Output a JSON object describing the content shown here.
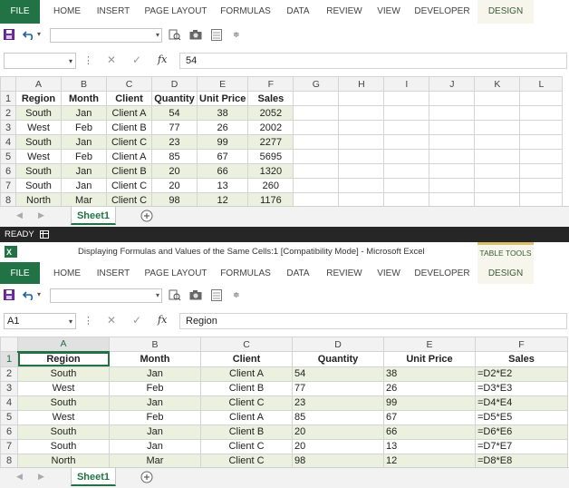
{
  "top": {
    "ribbon_tabs": [
      "FILE",
      "HOME",
      "INSERT",
      "PAGE LAYOUT",
      "FORMULAS",
      "DATA",
      "REVIEW",
      "VIEW",
      "DEVELOPER",
      "DESIGN"
    ],
    "name_box": "",
    "formula": "54",
    "columns": [
      "A",
      "B",
      "C",
      "D",
      "E",
      "F",
      "G",
      "H",
      "I",
      "J",
      "K",
      "L"
    ],
    "rows": [
      "1",
      "2",
      "3",
      "4",
      "5",
      "6",
      "7",
      "8"
    ],
    "header": [
      "Region",
      "Month",
      "Client",
      "Quantity",
      "Unit Price",
      "Sales"
    ],
    "data": [
      [
        "South",
        "Jan",
        "Client A",
        "54",
        "38",
        "2052"
      ],
      [
        "West",
        "Feb",
        "Client B",
        "77",
        "26",
        "2002"
      ],
      [
        "South",
        "Jan",
        "Client C",
        "23",
        "99",
        "2277"
      ],
      [
        "West",
        "Feb",
        "Client A",
        "85",
        "67",
        "5695"
      ],
      [
        "South",
        "Jan",
        "Client B",
        "20",
        "66",
        "1320"
      ],
      [
        "South",
        "Jan",
        "Client C",
        "20",
        "13",
        "260"
      ],
      [
        "North",
        "Mar",
        "Client C",
        "98",
        "12",
        "1176"
      ]
    ],
    "sheet_tab": "Sheet1"
  },
  "status": {
    "text": "READY"
  },
  "title": {
    "text": "Displaying Formulas and Values of the Same Cells:1  [Compatibility Mode] - Microsoft Excel",
    "table_tools": "TABLE TOOLS"
  },
  "bottom": {
    "ribbon_tabs": [
      "FILE",
      "HOME",
      "INSERT",
      "PAGE LAYOUT",
      "FORMULAS",
      "DATA",
      "REVIEW",
      "VIEW",
      "DEVELOPER",
      "DESIGN"
    ],
    "name_box": "A1",
    "formula": "Region",
    "columns": [
      "A",
      "B",
      "C",
      "D",
      "E",
      "F"
    ],
    "rows": [
      "1",
      "2",
      "3",
      "4",
      "5",
      "6",
      "7",
      "8"
    ],
    "header": [
      "Region",
      "Month",
      "Client",
      "Quantity",
      "Unit Price",
      "Sales"
    ],
    "data": [
      [
        "South",
        "Jan",
        "Client A",
        "54",
        "38",
        "=D2*E2"
      ],
      [
        "West",
        "Feb",
        "Client B",
        "77",
        "26",
        "=D3*E3"
      ],
      [
        "South",
        "Jan",
        "Client C",
        "23",
        "99",
        "=D4*E4"
      ],
      [
        "West",
        "Feb",
        "Client A",
        "85",
        "67",
        "=D5*E5"
      ],
      [
        "South",
        "Jan",
        "Client B",
        "20",
        "66",
        "=D6*E6"
      ],
      [
        "South",
        "Jan",
        "Client C",
        "20",
        "13",
        "=D7*E7"
      ],
      [
        "North",
        "Mar",
        "Client C",
        "98",
        "12",
        "=D8*E8"
      ]
    ],
    "sheet_tab": "Sheet1"
  },
  "colors": {
    "excel_green": "#217346",
    "band": "#ebf1de",
    "status_bg": "#262626"
  },
  "icons": {
    "save": "save-icon",
    "undo": "undo-icon",
    "print-preview": "print-preview-icon",
    "camera": "camera-icon",
    "form": "form-icon",
    "cancel": "cancel-icon",
    "enter": "enter-icon",
    "function": "function-icon",
    "add-sheet": "add-sheet-icon",
    "excel-logo": "excel-logo-icon",
    "normal-view": "normal-view-icon"
  }
}
